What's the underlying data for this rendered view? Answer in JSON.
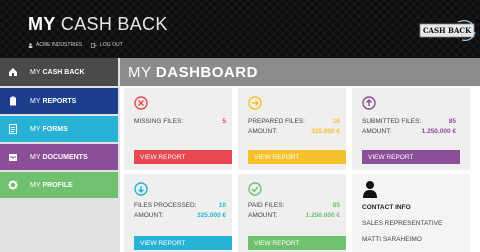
{
  "header": {
    "title_bold": "MY",
    "title_light": "CASH BACK",
    "company": "ACME INDUSTRIES",
    "logout": "LOG OUT",
    "logo_text": "CASH BACK"
  },
  "sidebar": {
    "items": [
      {
        "prefix": "MY",
        "label": "CASH BACK",
        "icon": "home-icon"
      },
      {
        "prefix": "MY",
        "label": "REPORTS",
        "icon": "clipboard-icon"
      },
      {
        "prefix": "MY",
        "label": "FORMS",
        "icon": "form-icon"
      },
      {
        "prefix": "MY",
        "label": "DOCUMENTS",
        "icon": "inbox-icon"
      },
      {
        "prefix": "MY",
        "label": "PROFILE",
        "icon": "gear-icon"
      }
    ]
  },
  "dashboard": {
    "title_prefix": "MY",
    "title": "DASHBOARD"
  },
  "cards": {
    "missing": {
      "label": "MISSING FILES:",
      "value": "5",
      "button": "VIEW REPORT",
      "color": "#e8484f"
    },
    "prepared": {
      "label": "PREPARED FILES:",
      "value": "10",
      "amount_label": "AMOUNT:",
      "amount": "325.000 €",
      "button": "VIEW REPORT",
      "color": "#f6c12a"
    },
    "submitted": {
      "label": "SUBMITTED FILES:",
      "value": "85",
      "amount_label": "AMOUNT:",
      "amount": "1.250.000 €",
      "button": "VIEW REPORT",
      "color": "#8b4f98"
    },
    "processed": {
      "label": "FILES PROCESSED:",
      "value": "10",
      "amount_label": "AMOUNT:",
      "amount": "325.000 €",
      "button": "VIEW REPORT",
      "color": "#28b3d6"
    },
    "paid": {
      "label": "PAID FILES:",
      "value": "85",
      "amount_label": "AMOUNT:",
      "amount": "1.250.000 €",
      "button": "VIEW REPORT",
      "color": "#70c16d"
    }
  },
  "contact": {
    "title": "CONTACT INFO",
    "role": "SALES REPRESENTATIVE",
    "name": "MATTI SARAHEIMO"
  }
}
